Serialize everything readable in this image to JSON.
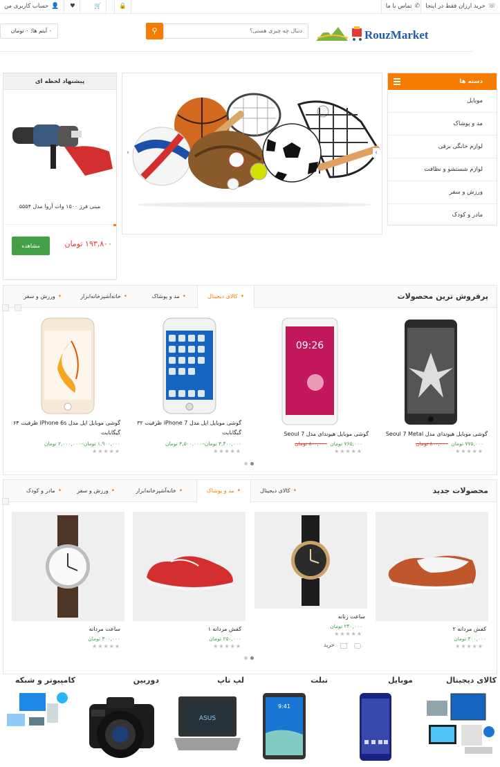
{
  "topbar": {
    "promo": "خرید ارزان فقط در اینجا",
    "contact": "تماس با ما",
    "account": "حساب کاربری من"
  },
  "logo": {
    "text": "RouzMarket"
  },
  "search": {
    "placeholder": "دنبال چه چیزی هستی؟"
  },
  "cart": {
    "label": "۰ آیتم ها: ۰ تومان"
  },
  "categories": {
    "title": "دسته ها",
    "items": [
      "موبایل",
      "مد و پوشاک",
      "لوازم خانگی برقی",
      "لوازم شستشو و نظافت",
      "ورزش و سفر",
      "مادر و کودک"
    ]
  },
  "offer": {
    "title": "پیشنهاد لحظه ای",
    "product": "مینی فرز ۱۵۰۰ وات آروا مدل ۵۵۵۴",
    "price": "۱۹۳,۸۰۰ تومان",
    "button": "مشاهده"
  },
  "bestsellers": {
    "title": "پرفروش ترین محصولات",
    "tabs": [
      "کالای دیجیتال",
      "مد و پوشاک",
      "خانه‌آشپزخانه‌ابزار",
      "ورزش و سفر"
    ],
    "products": [
      {
        "name": "گوشی موبایل هیوندای مدل Seoul 7 Metal",
        "price": "۷۷۵,۰۰۰ تومان",
        "old": "۸۰۰,۰۰۰ تومان"
      },
      {
        "name": "گوشی موبایل هیوندای مدل Seoul 7",
        "price": "۷۶۵,۰۰۰ تومان",
        "old": "۸۰۰,۰۰۰ تومان"
      },
      {
        "name": "گوشی موبایل اپل مدل iPhone 7 ظرفیت ۳۲ گیگابایت",
        "price": "۳,۴۰۰,۰۰۰ تومان–۳,۵۰۰,۰۰۰ تومان",
        "old": ""
      },
      {
        "name": "گوشی موبایل اپل مدل iPhone 6s ظرفیت ۶۴ گیگابایت",
        "price": "۱,۹۰۰,۰۰۰ تومان–۲,۰۰۰,۰۰۰ تومان",
        "old": ""
      }
    ]
  },
  "newproducts": {
    "title": "محصولات جدید",
    "tabs": [
      "کالای دیجیتال",
      "مد و پوشاک",
      "خانه‌آشپزخانه‌ابزار",
      "ورزش و سفر",
      "مادر و کودک"
    ],
    "products": [
      {
        "name": "کفش مردانه ۲",
        "price": "۳۰۰,۰۰۰ تومان"
      },
      {
        "name": "ساعت زنانه",
        "price": "۲۴۰,۰۰۰ تومان",
        "buy": "خرید"
      },
      {
        "name": "کفش مردانه ۱",
        "price": "۲۵۰,۰۰۰ تومان"
      },
      {
        "name": "ساعت مردانه",
        "price": "۳۰۰,۰۰۰ تومان"
      }
    ]
  },
  "bottomcats": [
    "کالای دیجیتال",
    "موبایل",
    "تبلت",
    "لپ تاپ",
    "دوربین",
    "کامپیوتر و شبکه"
  ],
  "stars": "★★★★★",
  "colors": {
    "accent": "#f57c00",
    "green": "#43a047",
    "red": "#e53935"
  }
}
